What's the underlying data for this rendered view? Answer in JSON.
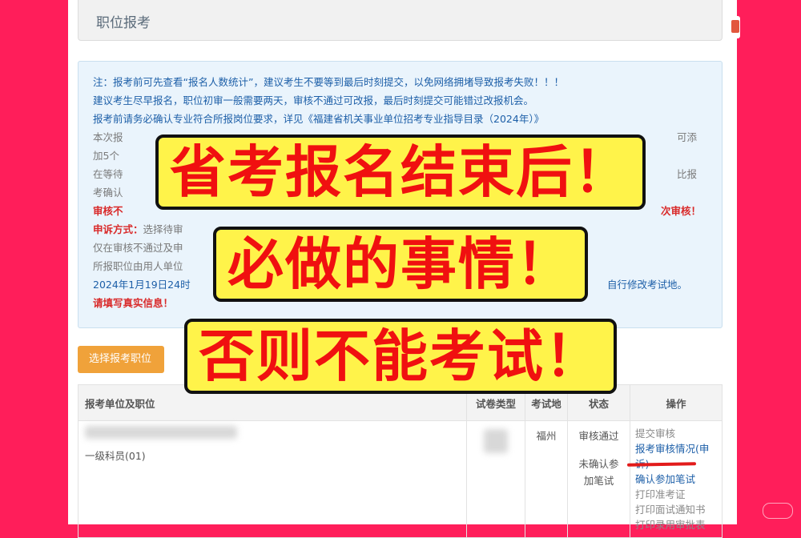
{
  "header": {
    "title": "职位报考"
  },
  "notice": {
    "line1": "注：报考前可先查看“报名人数统计”，建议考生不要等到最后时刻提交，以免网络拥堵导致报考失败！！！",
    "line2": "建议考生尽早报名，职位初审一般需要两天，审核不通过可改报，最后时刻提交可能错过改报机会。",
    "line3": "报考前请务必确认专业符合所报岗位要求，详见《福建省机关事业单位招考专业指导目录（2024年）》",
    "line4_left": "本次报",
    "line4_right": "可添",
    "line5_left": "加5个",
    "line6_left": "在等待",
    "line6_right": "比报",
    "line7_left": "考确认",
    "line8_left": "审核不",
    "line8_right": "次审核！",
    "line9_label": "申诉方式：",
    "line9_text": "选择待审",
    "line10_left": "仅在审核不通过及申",
    "line11_left": "所报职位由用人单位",
    "line12_left": "2024年1月19日24时",
    "line12_right": "自行修改考试地。",
    "line13_left": "请填写真实信息！"
  },
  "select_button": {
    "label": "选择报考职位"
  },
  "table": {
    "headers": [
      "报考单位及职位",
      "试卷类型",
      "考试地",
      "状态",
      "操作"
    ],
    "row": {
      "position": "一级科员(01)",
      "exam_location": "福州",
      "status_1": "审核通过",
      "status_2": "未确认参",
      "status_3": "加笔试",
      "ops": [
        "提交审核",
        "报考审核情况(申诉)",
        "确认参加笔试",
        "打印准考证",
        "打印面试通知书",
        "打印录用审批表"
      ]
    }
  },
  "overlay": {
    "line1": "省考报名结束后！",
    "line2": "必做的事情！",
    "line3": "否则不能考试！"
  },
  "colors": {
    "accent": "#1d5fa8",
    "warning": "#d92a2a",
    "button": "#f0a23a",
    "frame": "#ff1e5a"
  }
}
